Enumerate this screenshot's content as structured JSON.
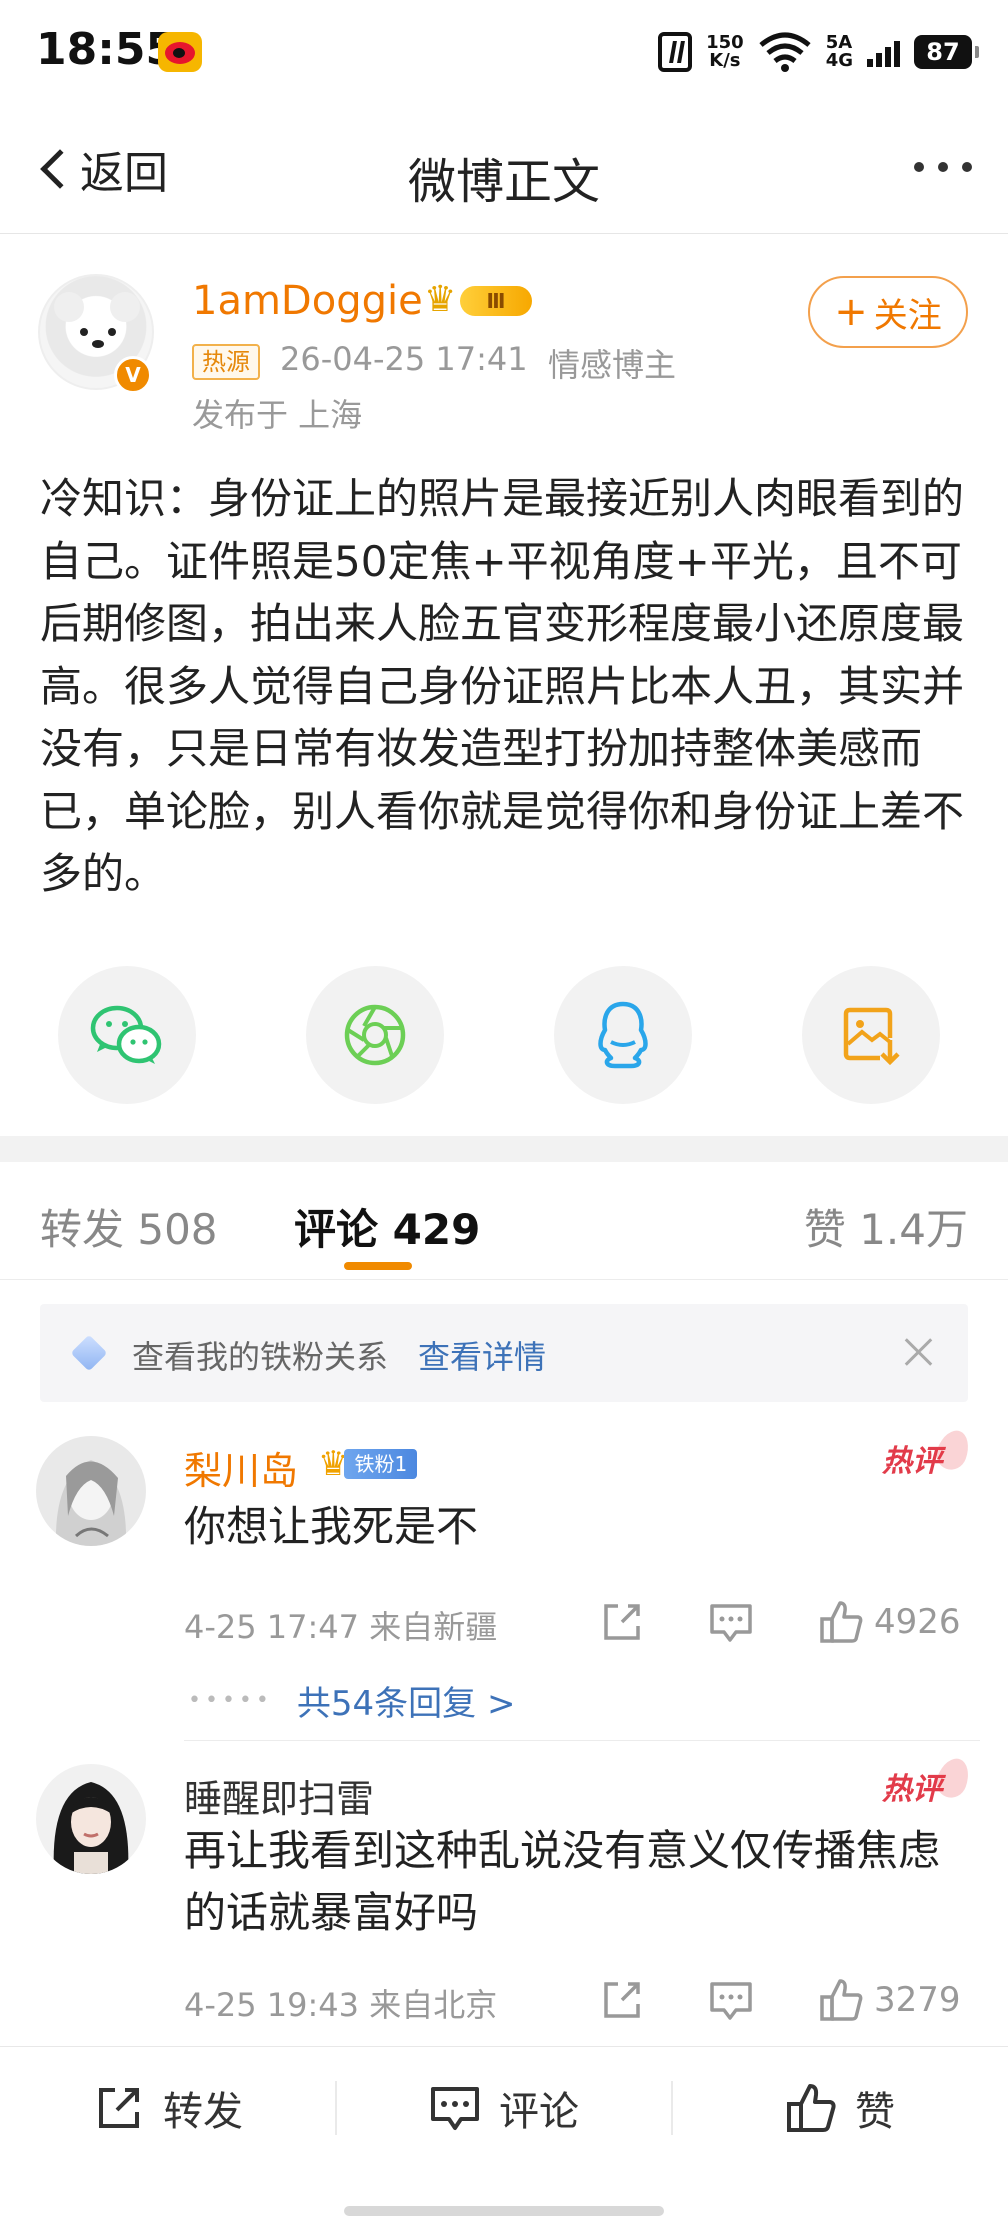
{
  "status_bar": {
    "time": "18:55",
    "net_speed_top": "150",
    "net_speed_bottom": "K/s",
    "signal_label_top": "5A",
    "signal_label_bottom": "4G",
    "battery": "87",
    "icons": [
      "weibo-app-icon",
      "nfc-icon",
      "wifi-icon",
      "cell-signal-icon",
      "battery-icon"
    ]
  },
  "header": {
    "back_label": "返回",
    "title": "微博正文"
  },
  "author": {
    "name": "1amDoggie",
    "level_badge": "Ⅲ",
    "hot_tag": "热源",
    "time": "26-04-25 17:41",
    "category": "情感博主",
    "location": "发布于 上海",
    "follow_label": "关注"
  },
  "post": {
    "text": "冷知识：身份证上的照片是最接近别人肉眼看到的自己。证件照是50定焦+平视角度+平光，且不可后期修图，拍出来人脸五官变形程度最小还原度最高。很多人觉得自己身份证照片比本人丑，其实并没有，只是日常有妆发造型打扮加持整体美感而已，单论脸，别人看你就是觉得你和身份证上差不多的。"
  },
  "share": {
    "items": [
      "wechat-icon",
      "moments-icon",
      "qq-icon",
      "save-image-icon"
    ],
    "colors": {
      "wechat": "#2fc472",
      "moments": "#6ccf55",
      "qq": "#2aa6ea",
      "save": "#f2a31a"
    }
  },
  "tabs": {
    "repost": "转发 508",
    "comment": "评论 429",
    "like": "赞 1.4万"
  },
  "fan_banner": {
    "text": "查看我的铁粉关系",
    "link": "查看详情"
  },
  "comments": [
    {
      "name": "梨川岛",
      "fan_label": "铁粉1",
      "hot_label": "热评",
      "text": "你想让我死是不",
      "meta": "4-25 17:47 来自新疆",
      "likes": "4926",
      "replies": "共54条回复 >"
    },
    {
      "name": "睡醒即扫雷",
      "hot_label": "热评",
      "text": "再让我看到这种乱说没有意义仅传播焦虑的话就暴富好吗",
      "meta": "4-25 19:43 来自北京",
      "likes": "3279"
    }
  ],
  "bottom_bar": {
    "repost": "转发",
    "comment": "评论",
    "like": "赞"
  },
  "accent_color": "#f07800",
  "link_color": "#3d72b8"
}
